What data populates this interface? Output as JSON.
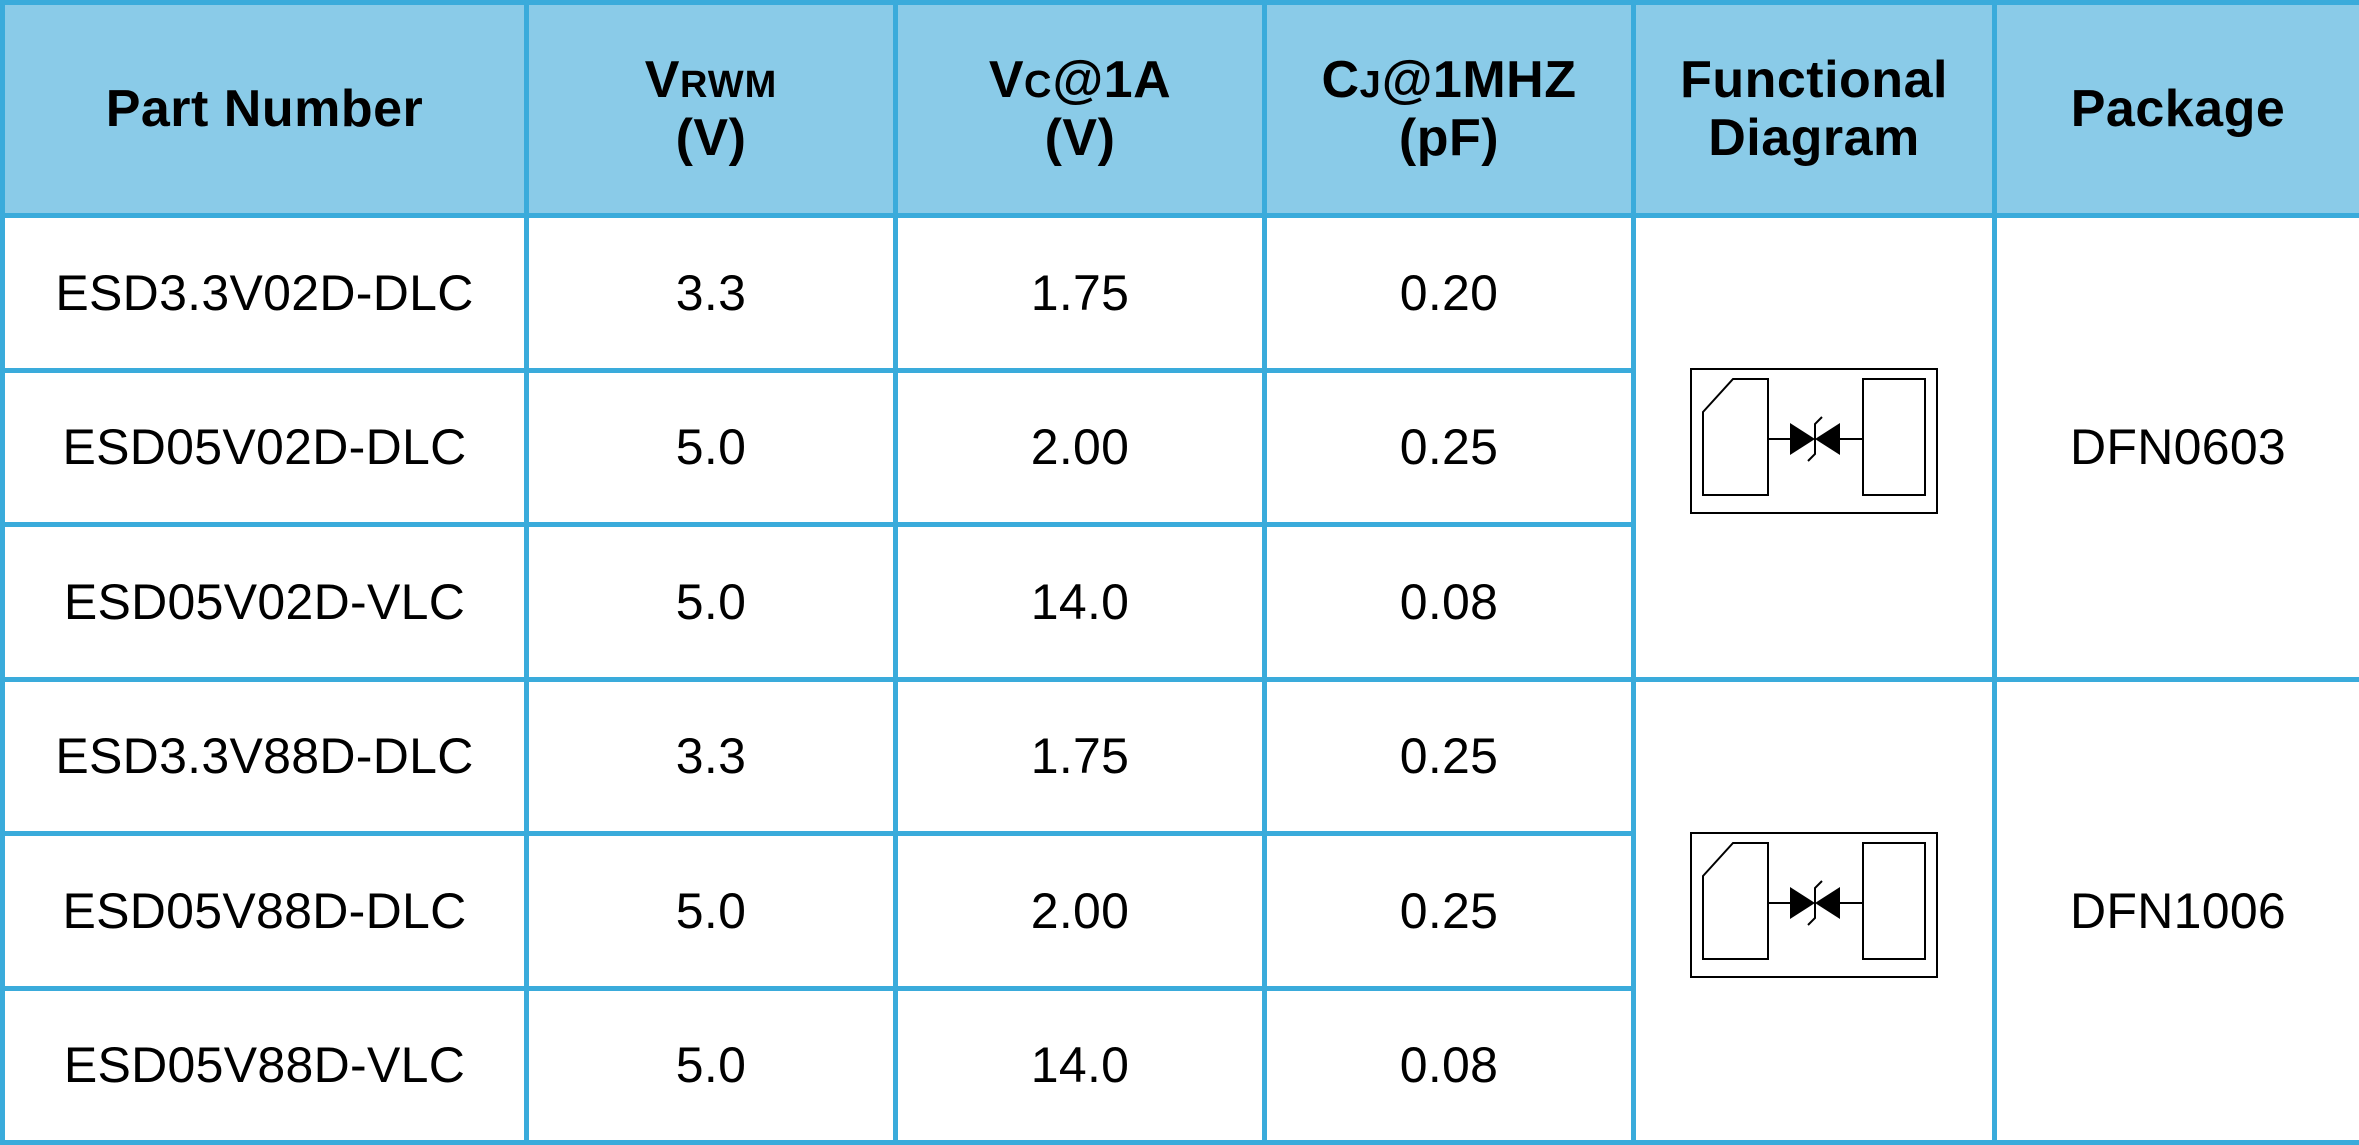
{
  "table": {
    "headers": {
      "part_number": "Part Number",
      "vrwm": {
        "main": "V",
        "sub": "RWM",
        "unit": "(V)"
      },
      "vc": {
        "main": "V",
        "sub": "C",
        "rest": "@1A",
        "unit": "(V)"
      },
      "cj": {
        "main": "C",
        "sub": "J",
        "rest": "@1MHZ",
        "unit": "(pF)"
      },
      "functional_diagram": {
        "line1": "Functional",
        "line2": "Diagram"
      },
      "package": "Package"
    },
    "rows": [
      {
        "part_number": "ESD3.3V02D-DLC",
        "vrwm": "3.3",
        "vc": "1.75",
        "cj": "0.20"
      },
      {
        "part_number": "ESD05V02D-DLC",
        "vrwm": "5.0",
        "vc": "2.00",
        "cj": "0.25"
      },
      {
        "part_number": "ESD05V02D-VLC",
        "vrwm": "5.0",
        "vc": "14.0",
        "cj": "0.08"
      },
      {
        "part_number": "ESD3.3V88D-DLC",
        "vrwm": "3.3",
        "vc": "1.75",
        "cj": "0.25"
      },
      {
        "part_number": "ESD05V88D-DLC",
        "vrwm": "5.0",
        "vc": "2.00",
        "cj": "0.25"
      },
      {
        "part_number": "ESD05V88D-VLC",
        "vrwm": "5.0",
        "vc": "14.0",
        "cj": "0.08"
      }
    ],
    "groups": [
      {
        "package": "DFN0603",
        "diagram_icon": "bidirectional-tvs-diode-icon",
        "rows": [
          0,
          1,
          2
        ]
      },
      {
        "package": "DFN1006",
        "diagram_icon": "bidirectional-tvs-diode-icon",
        "rows": [
          3,
          4,
          5
        ]
      }
    ]
  },
  "colors": {
    "header_fill": "#8acbe8",
    "border": "#3aabdb",
    "text": "#000000"
  }
}
